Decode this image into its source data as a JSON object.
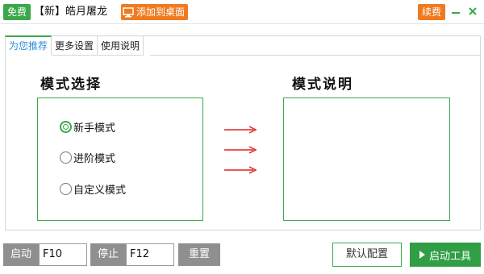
{
  "titlebar": {
    "free_badge": "免费",
    "title": "【新】皓月屠龙",
    "add_desktop_label": "添加到桌面",
    "renew_label": "续费",
    "minimize_icon": "minimize-icon",
    "close_icon": "close-icon"
  },
  "tabs": [
    {
      "label": "为您推荐",
      "active": true
    },
    {
      "label": "更多设置",
      "active": false
    },
    {
      "label": "使用说明",
      "active": false
    }
  ],
  "mode_select": {
    "title": "模式选择",
    "options": [
      {
        "label": "新手模式",
        "checked": true
      },
      {
        "label": "进阶模式",
        "checked": false
      },
      {
        "label": "自定义模式",
        "checked": false
      }
    ]
  },
  "mode_desc": {
    "title": "模式说明"
  },
  "bottom": {
    "start_label": "启动",
    "start_hotkey": "F10",
    "stop_label": "停止",
    "stop_hotkey": "F12",
    "reset_label": "重置",
    "default_config_label": "默认配置",
    "start_tool_label": "启动工具"
  },
  "colors": {
    "green": "#3aa84a",
    "orange": "#f07a1f",
    "arrow_red": "#e02020",
    "gray_button": "#8f8f8f"
  }
}
